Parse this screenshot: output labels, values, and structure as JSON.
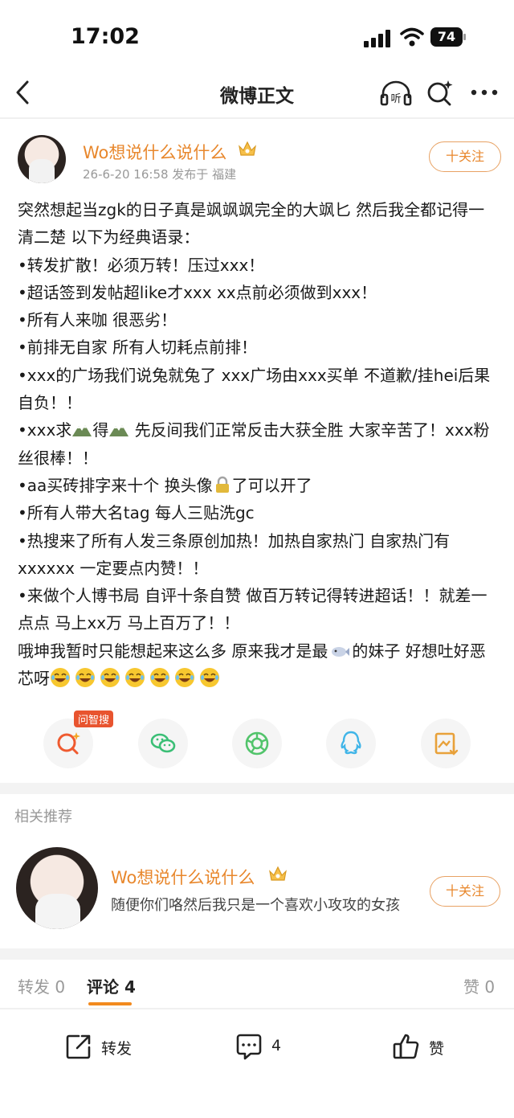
{
  "status_bar": {
    "time": "17:02",
    "battery": "74"
  },
  "nav": {
    "title": "微博正文",
    "listen_label": "听"
  },
  "post": {
    "author": {
      "name": "Wo想说什么说什么"
    },
    "meta": "26-6-20 16:58  发布于 福建",
    "follow_label": "十关注",
    "lines": {
      "l1": "突然想起当zgk的日子真是飒飒飒完全的大飒匕 然后我全都记得一清二楚 以下为经典语录：",
      "l2": "•转发扩散！必须万转！压过xxx！",
      "l3": "•超话签到发帖超like才xxx xx点前必须做到xxx！",
      "l4": "•所有人来咖 很恶劣！",
      "l5": "•前排无自家 所有人切耗点前排！",
      "l6": "•xxx的广场我们说兔就兔了 xxx广场由xxx买单 不道歉/挂hei后果自负！！",
      "l7a": "•xxx求",
      "l7b": "得",
      "l7c": " 先反间我们正常反击大获全胜 大家辛苦了！xxx粉丝很棒！！",
      "l8a": "•aa买砖排字来十个 换头像",
      "l8b": "了可以开了",
      "l9": "•所有人带大名tag 每人三贴洗gc",
      "l10": "•热搜来了所有人发三条原创加热！加热自家热门 自家热门有xxxxxx 一定要点内赞！！",
      "l11": "•来做个人博书局 自评十条自赞 做百万转记得转进超话！！就差一点点 马上xx万 马上百万了！！",
      "l12a": "哦坤我暂时只能想起来这么多 原来我才是最",
      "l12b": "的妹子 好想吐好恶芯呀"
    },
    "emojis": [
      "mountain-icon",
      "mountain-icon",
      "lock-icon",
      "fish-icon",
      "laugh-cry-icon"
    ]
  },
  "share": {
    "badge": "问智搜",
    "items": [
      "wenzhisou-icon",
      "wechat-icon",
      "moments-icon",
      "qq-icon",
      "save-image-icon"
    ]
  },
  "related": {
    "title": "相关推荐",
    "name": "Wo想说什么说什么",
    "bio": "随便你们咯然后我只是一个喜欢小攻攻的女孩",
    "follow_label": "十关注"
  },
  "tabs": {
    "repost": "转发 0",
    "comment": "评论 4",
    "like": "赞 0"
  },
  "toolbar": {
    "repost": "转发",
    "comment": "4",
    "like": "赞"
  },
  "colors": {
    "accent": "#e8872c",
    "tab_underline": "#f28a1e",
    "badge": "#e8542f"
  }
}
